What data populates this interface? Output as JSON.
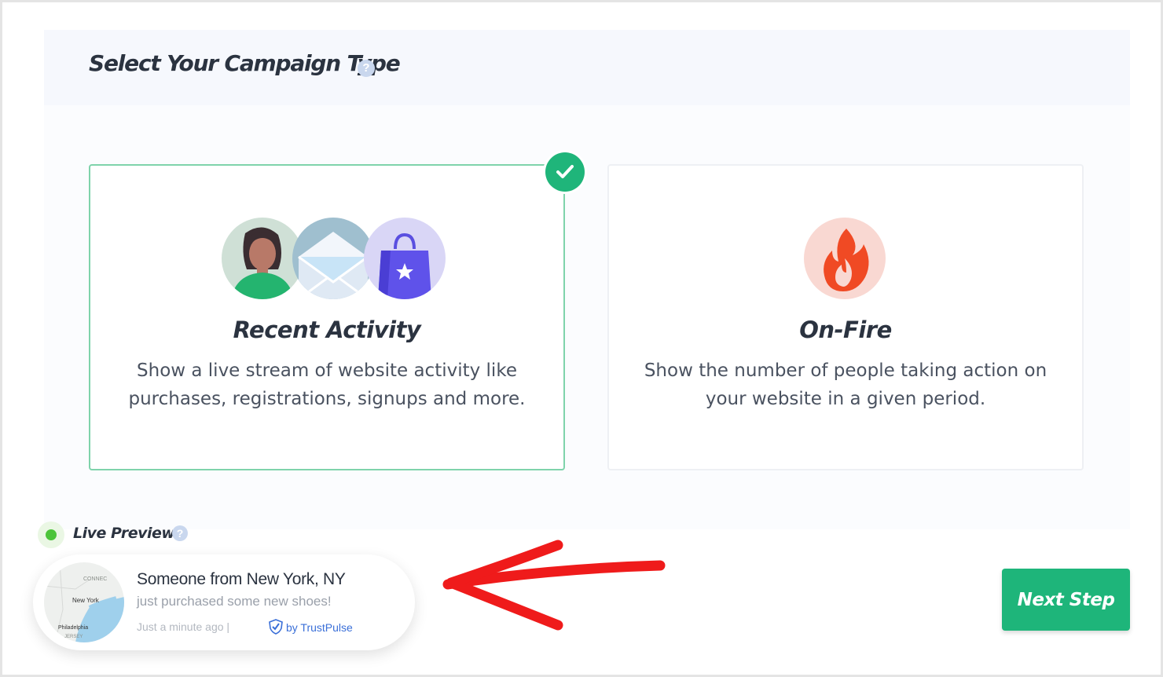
{
  "header": {
    "title": "Select Your Campaign Type",
    "help_glyph": "?"
  },
  "cards": [
    {
      "id": "recent-activity",
      "title": "Recent Activity",
      "description_line1": "Show a live stream of website activity like",
      "description_line2": "purchases, registrations, signups and more.",
      "selected": true,
      "icons": [
        "person-avatar-icon",
        "envelope-icon",
        "shopping-bag-icon"
      ]
    },
    {
      "id": "on-fire",
      "title": "On-Fire",
      "description_line1": "Show the number of people taking action on",
      "description_line2": "your website in a given period.",
      "selected": false,
      "icons": [
        "flame-icon"
      ]
    }
  ],
  "live_preview": {
    "label": "Live Preview",
    "help_glyph": "?",
    "notification": {
      "title": "Someone from New York, NY",
      "subtitle": "just purchased some new shoes!",
      "time": "Just a minute ago |",
      "branding": "by TrustPulse",
      "map_labels": [
        "CONNEC",
        "New York",
        "Philadelphia",
        "JERSEY"
      ]
    }
  },
  "footer": {
    "next_label": "Next Step"
  },
  "colors": {
    "accent_green": "#1eb57a",
    "selected_border": "#7fd3ab",
    "annotation_arrow": "#ef1b1b"
  }
}
